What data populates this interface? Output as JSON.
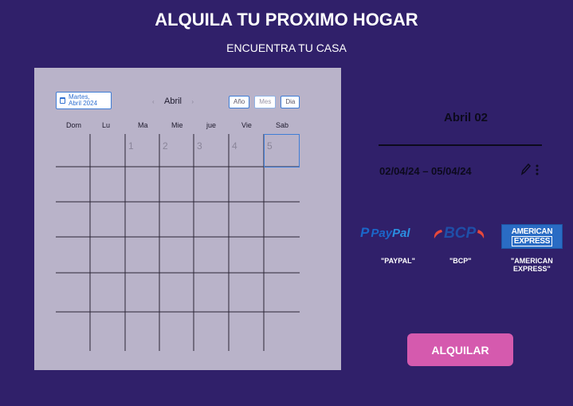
{
  "header": {
    "title": "ALQUILA TU PROXIMO HOGAR",
    "subtitle": "ENCUENTRA TU CASA"
  },
  "calendar": {
    "date_chip": "Martes,\nAbril 2024",
    "month": "Abril",
    "views": [
      "Año",
      "Mes",
      "Dia"
    ],
    "weekdays": [
      "Dom",
      "Lu",
      "Ma",
      "Mie",
      "jue",
      "Vie",
      "Sab"
    ],
    "first_row_days": [
      "1",
      "2",
      "3",
      "4",
      "5"
    ],
    "selected_day": "5"
  },
  "booking": {
    "title": "Abril 02",
    "range": "02/04/24 – 05/04/24"
  },
  "payments": {
    "paypal": {
      "logo_mark": "P",
      "logo_pay": "Pay",
      "logo_pal": "Pal",
      "label": "\"PAYPAL\""
    },
    "bcp": {
      "logo_text": "BCP",
      "label": "\"BCP\""
    },
    "amex": {
      "logo_line1": "AMERICAN",
      "logo_line2": "EXPRESS",
      "label": "\"AMERICAN\nEXPRESS\""
    }
  },
  "actions": {
    "rent_label": "ALQUILAR"
  },
  "colors": {
    "background": "#30206a",
    "calendar_bg": "#b9b3c9",
    "accent_button": "#d55aae",
    "selection": "#3f7dd6"
  }
}
